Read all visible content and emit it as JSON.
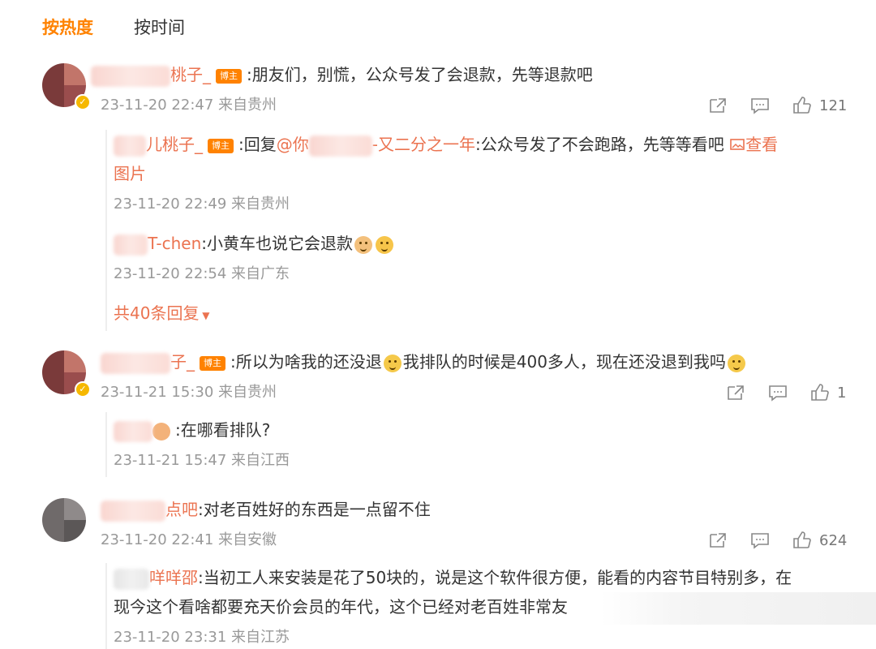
{
  "tabs": {
    "hot": "按热度",
    "time": "按时间"
  },
  "comments": [
    {
      "name_suffix": "桃子_",
      "tag": "博主",
      "text": ":朋友们，别慌，公众号发了会退款，先等退款吧",
      "meta": "23-11-20 22:47 来自贵州",
      "likes": "121",
      "replies": [
        {
          "name": "儿桃子_",
          "tag": "博主",
          "text_prefix": ":回复",
          "mention_start": "@你",
          "mention_end": "-又二分之一年",
          "text_suffix": ":公众号发了不会跑路，先等等看吧",
          "view_image_1": "查看",
          "view_image_2": "图片",
          "meta": "23-11-20 22:49 来自贵州"
        },
        {
          "name": "T-chen",
          "text": ":小黄车也说它会退款",
          "meta": "23-11-20 22:54 来自广东"
        }
      ],
      "more_replies": "共40条回复"
    },
    {
      "name_suffix": "子_",
      "tag": "博主",
      "text_a": ":所以为啥我的还没退",
      "text_b": "我排队的时候是400多人，现在还没退到我吗",
      "meta": "23-11-21 15:30 来自贵州",
      "likes": "1",
      "replies": [
        {
          "text": ":在哪看排队?",
          "meta": "23-11-21 15:47 来自江西"
        }
      ]
    },
    {
      "name_suffix": "点吧",
      "text": ":对老百姓好的东西是一点留不住",
      "meta": "23-11-20 22:41 来自安徽",
      "likes": "624",
      "replies": [
        {
          "name": "咩咩邵",
          "text_line1": ":当初工人来安装是花了50块的，说是这个软件很方便，能看的内容节目特别多，在",
          "text_line2": "现今这个看啥都要充天价会员的年代，这个已经对老百姓非常友",
          "meta": "23-11-20 23:31 来自江苏"
        }
      ]
    }
  ],
  "colors": {
    "accent": "#ff8200",
    "name": "#eb7350",
    "meta": "#999999"
  }
}
